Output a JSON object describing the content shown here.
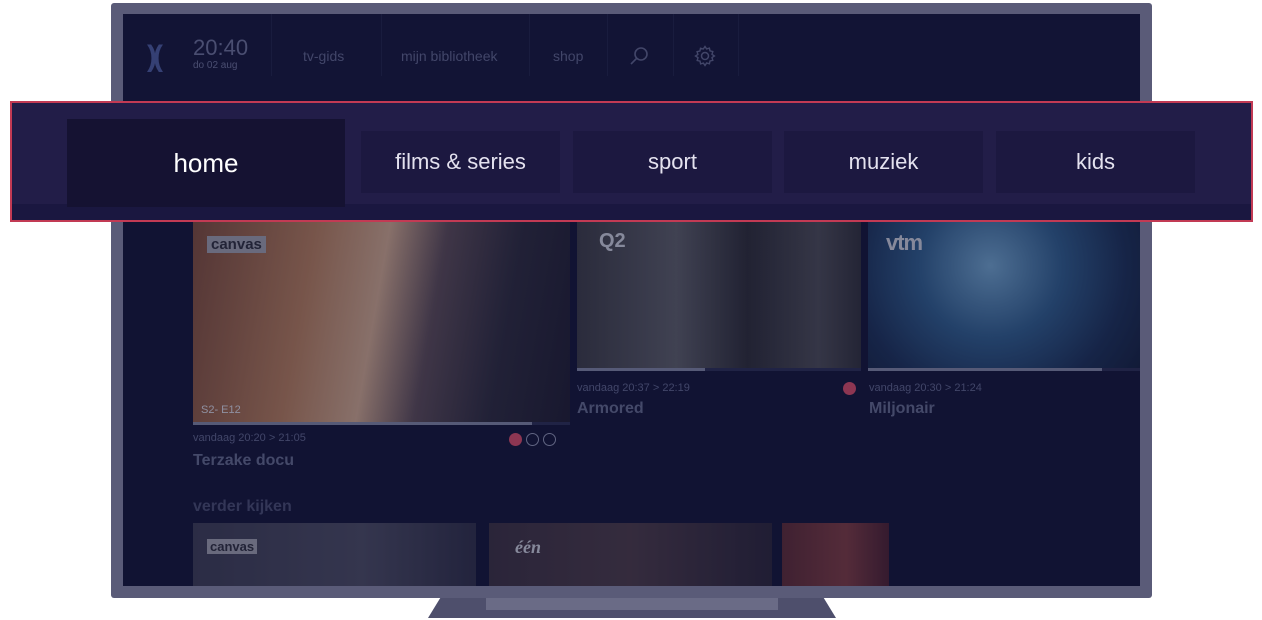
{
  "header": {
    "logo_glyph": ")(",
    "time": "20:40",
    "date": "do 02 aug",
    "nav": [
      {
        "label": "tv-gids"
      },
      {
        "label": "mijn bibliotheek"
      },
      {
        "label": "shop"
      }
    ],
    "icons": [
      "search-icon",
      "gear-icon"
    ]
  },
  "tabs": [
    {
      "label": "home",
      "active": true
    },
    {
      "label": "films & series",
      "active": false
    },
    {
      "label": "sport",
      "active": false
    },
    {
      "label": "muziek",
      "active": false
    },
    {
      "label": "kids",
      "active": false
    }
  ],
  "now_playing": [
    {
      "channel": "canvas",
      "episode": "S2- E12",
      "time": "vandaag  20:20 > 21:05",
      "title": "Terzake docu",
      "progress": 0.9
    },
    {
      "channel": "Q2",
      "time": "vandaag  20:37 > 22:19",
      "title": "Armored",
      "progress": 0.45
    },
    {
      "channel": "vtm",
      "time": "vandaag  20:30 > 21:24",
      "title": "Miljonair",
      "progress": 0.86
    }
  ],
  "continue_watching": {
    "label": "verder kijken",
    "items": [
      {
        "channel": "canvas"
      },
      {
        "channel": "één"
      },
      {
        "channel": ""
      }
    ]
  },
  "colors": {
    "accent_red": "#c23a54",
    "record_red": "#d24a66",
    "screen_bg": "#131537"
  }
}
